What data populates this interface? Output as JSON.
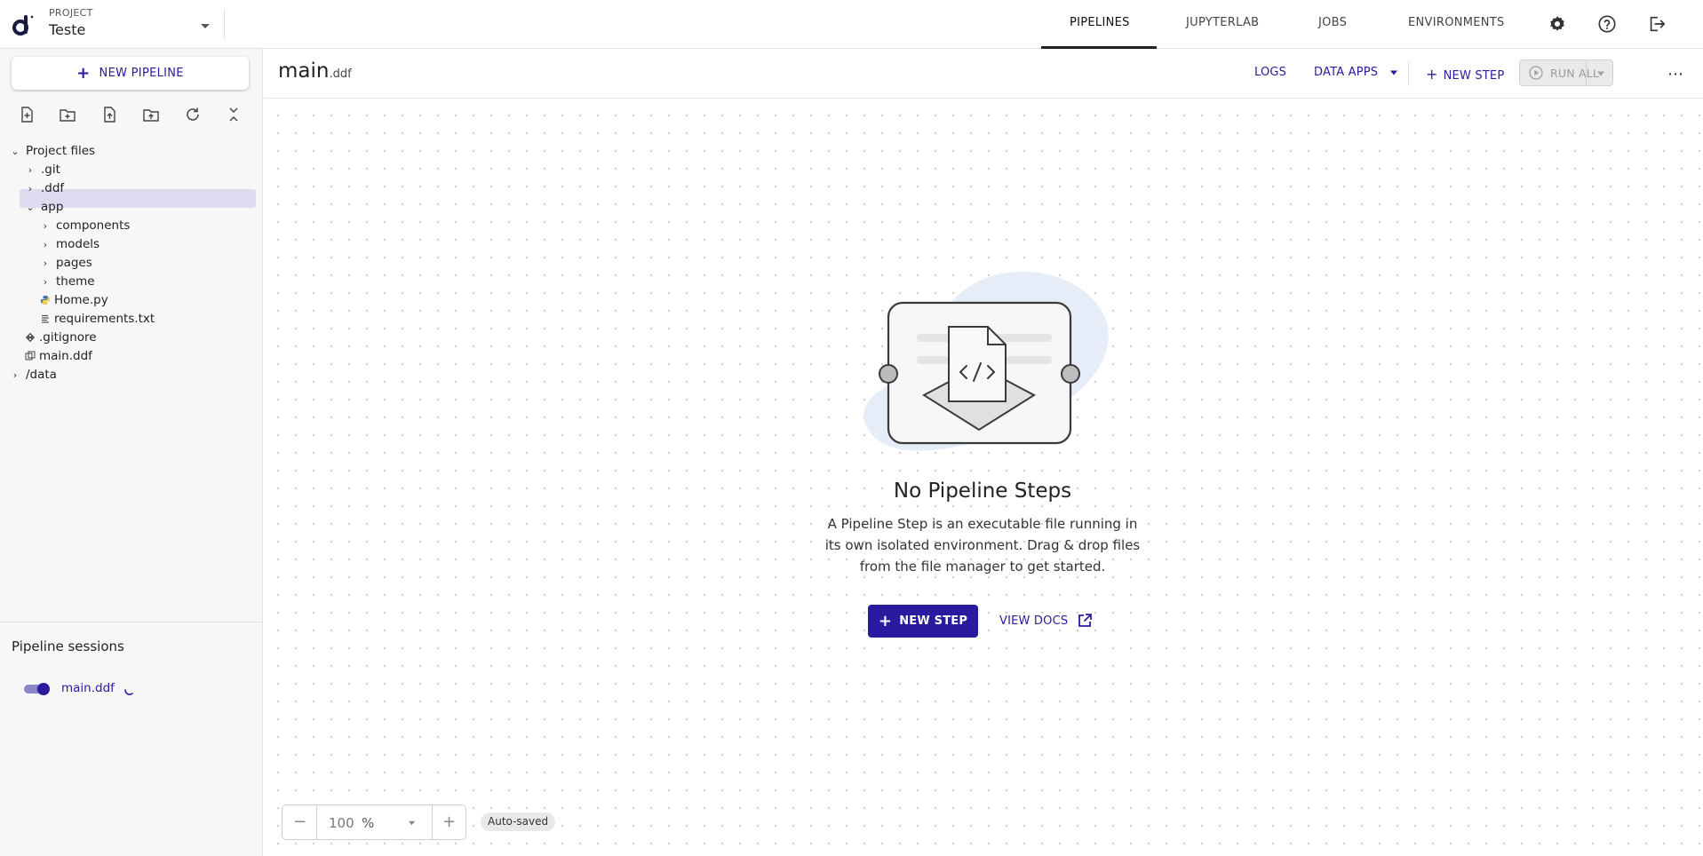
{
  "header": {
    "project_label": "PROJECT",
    "project_name": "Teste",
    "tabs": [
      {
        "label": "PIPELINES",
        "active": true
      },
      {
        "label": "JUPYTERLAB",
        "active": false
      },
      {
        "label": "JOBS",
        "active": false
      },
      {
        "label": "ENVIRONMENTS",
        "active": false
      }
    ],
    "icons": [
      "settings-icon",
      "help-icon",
      "logout-icon"
    ]
  },
  "sidebar": {
    "new_pipeline_label": "NEW PIPELINE",
    "toolbar_icons": [
      "new-file-icon",
      "new-folder-icon",
      "upload-file-icon",
      "upload-folder-icon",
      "refresh-icon",
      "collapse-all-icon"
    ],
    "tree": [
      {
        "label": "Project files",
        "type": "folder",
        "expanded": true,
        "depth": 0
      },
      {
        "label": ".git",
        "type": "folder",
        "expanded": false,
        "depth": 1
      },
      {
        "label": ".ddf",
        "type": "folder",
        "expanded": false,
        "depth": 1
      },
      {
        "label": "app",
        "type": "folder",
        "expanded": true,
        "depth": 1,
        "selected": true
      },
      {
        "label": "components",
        "type": "folder",
        "expanded": false,
        "depth": 2
      },
      {
        "label": "models",
        "type": "folder",
        "expanded": false,
        "depth": 2
      },
      {
        "label": "pages",
        "type": "folder",
        "expanded": false,
        "depth": 2
      },
      {
        "label": "theme",
        "type": "folder",
        "expanded": false,
        "depth": 2
      },
      {
        "label": "Home.py",
        "type": "python-file",
        "depth": 2
      },
      {
        "label": "requirements.txt",
        "type": "text-file",
        "depth": 2
      },
      {
        "label": ".gitignore",
        "type": "git-file",
        "depth": 1
      },
      {
        "label": "main.ddf",
        "type": "pipeline-file",
        "depth": 1
      },
      {
        "label": "/data",
        "type": "folder",
        "expanded": false,
        "depth": 0
      }
    ],
    "sessions": {
      "title": "Pipeline sessions",
      "items": [
        {
          "name": "main.ddf",
          "running": true
        }
      ]
    }
  },
  "toolbar": {
    "pipeline_name": "main",
    "pipeline_ext": ".ddf",
    "logs_label": "LOGS",
    "data_apps_label": "DATA APPS",
    "new_step_label": "NEW STEP",
    "run_all_label": "RUN ALL"
  },
  "canvas": {
    "empty_title": "No Pipeline Steps",
    "empty_description": "A Pipeline Step is an executable file running in its own isolated environment. Drag & drop files from the file manager to get started.",
    "new_step_label": "NEW STEP",
    "view_docs_label": "VIEW DOCS",
    "zoom_value": "100",
    "zoom_unit": "%",
    "autosaved_label": "Auto-saved"
  },
  "colors": {
    "accent": "#2a1aa0",
    "selected_row": "#dfdaf0",
    "illustration_blob": "#e6ecf8"
  }
}
